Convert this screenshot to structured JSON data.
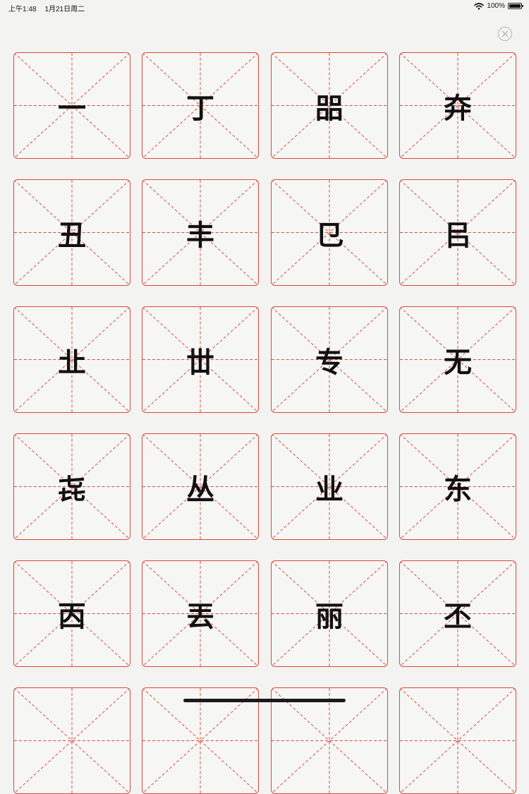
{
  "status_bar": {
    "time": "上午1:48",
    "date": "1月21日周二",
    "battery_text": "100%",
    "wifi_icon": "wifi-icon",
    "battery_icon": "battery-icon",
    "battery_level": 1.0
  },
  "close_button": {
    "icon": "close-icon"
  },
  "grid": {
    "line_color": "#d84a3c",
    "characters": [
      "一",
      "丁",
      "㗊",
      "㚏",
      "丑",
      "丰",
      "㔾",
      "㠯",
      "㐀",
      "丗",
      "专",
      "无",
      "㐂",
      "丛",
      "业",
      "东",
      "㐁",
      "丟",
      "丽",
      "丕",
      "",
      "",
      "",
      ""
    ]
  }
}
